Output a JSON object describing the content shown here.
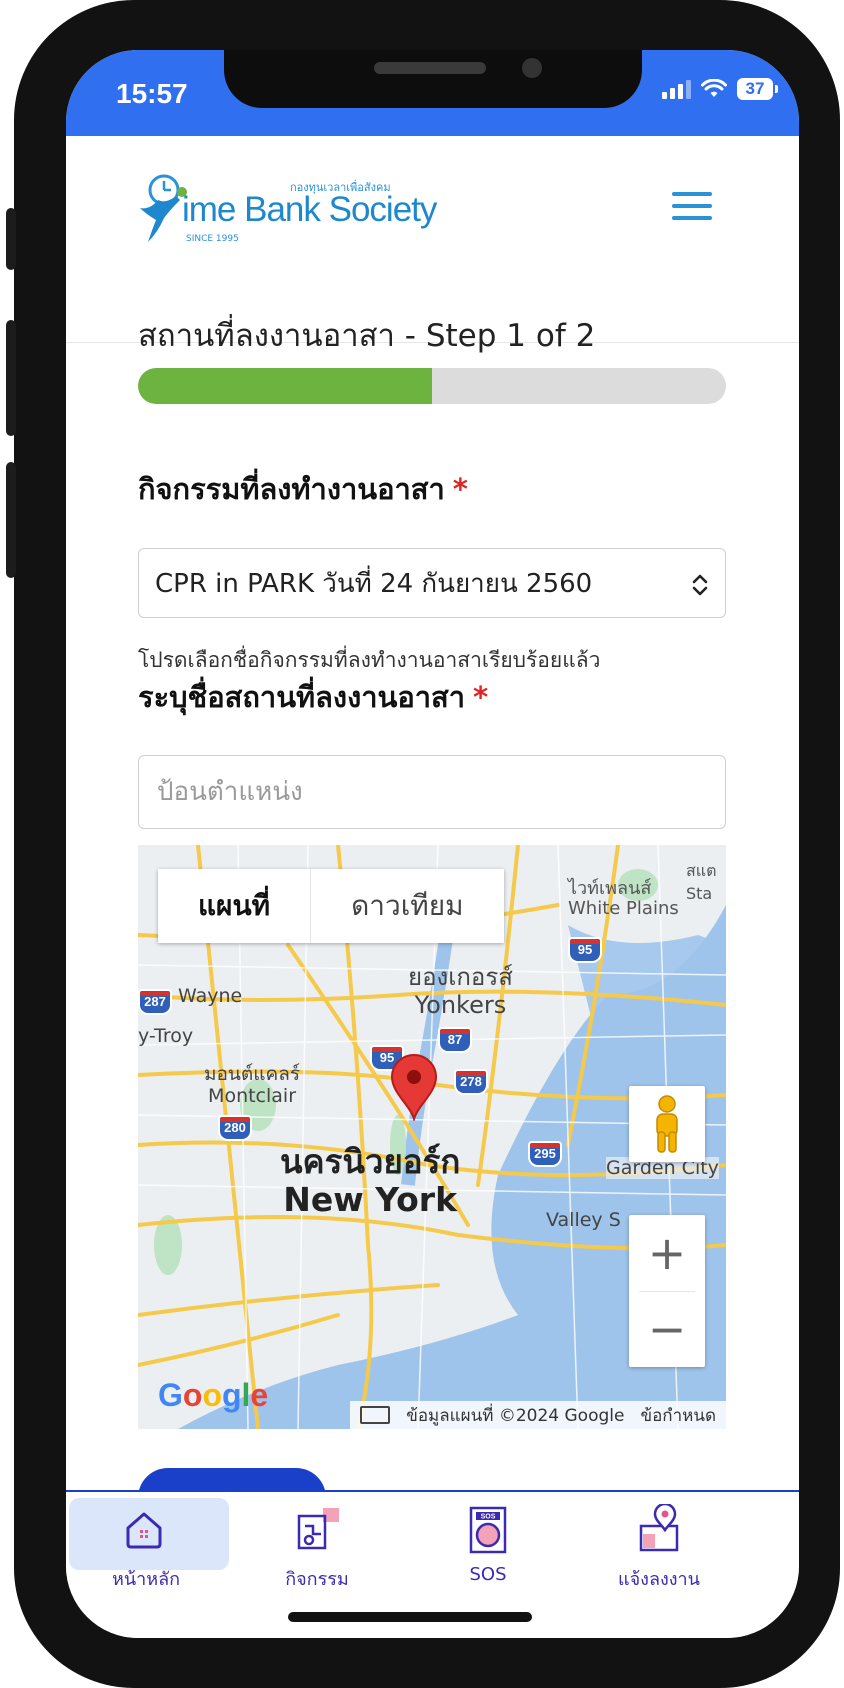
{
  "status_bar": {
    "time": "15:57",
    "battery": "37"
  },
  "header": {
    "logo_text": "ime Bank Society",
    "logo_thai": "กองทุนเวลาเพื่อสังคม",
    "logo_since": "SINCE 1995"
  },
  "form": {
    "step_title": "สถานที่ลงงานอาสา - Step 1 of 2",
    "progress": 0.5,
    "activity_label": "กิจกรรมที่ลงทำงานอาสา",
    "activity_required": "*",
    "activity_value": "CPR in PARK วันที่ 24 กันยายน  2560",
    "activity_help": "โปรดเลือกชื่อกิจกรรมที่ลงทำงานอาสาเรียบร้อยแล้ว",
    "location_label": "ระบุชื่อสถานที่ลงงานอาสา",
    "location_required": "*",
    "location_placeholder": "ป้อนตำแหน่ง"
  },
  "map": {
    "tab_map": "แผนที่",
    "tab_satellite": "ดาวเทียม",
    "labels": {
      "white_plains_th": "ไวท์เพลนส์",
      "white_plains_en": "White Plains",
      "yonkers_th": "ยองเกอรส์",
      "yonkers_en": "Yonkers",
      "wayne": "Wayne",
      "troy": "y-Troy",
      "montclair_th": "มอนต์แคลร์",
      "montclair_en": "Montclair",
      "new_york_th": "นครนิวยอร์ก",
      "new_york_en": "New York",
      "garden_city": "Garden City",
      "valley_stream": "Valley S",
      "stamford": "สแต Sta"
    },
    "highway_shields": [
      "287",
      "95",
      "87",
      "95",
      "278",
      "280",
      "295"
    ],
    "zoom_in": "+",
    "zoom_out": "−",
    "google_logo": "Google",
    "attribution": "ข้อมูลแผนที่ ©2024 Google",
    "terms": "ข้อกำหนด"
  },
  "nav": [
    {
      "label": "หน้าหลัก",
      "icon": "home-icon"
    },
    {
      "label": "กิจกรรม",
      "icon": "activity-icon"
    },
    {
      "label": "SOS",
      "icon": "sos-icon"
    },
    {
      "label": "แจ้งลงงาน",
      "icon": "report-location-icon"
    }
  ],
  "colors": {
    "status_bar": "#2f6ff0",
    "progress": "#6cb43f",
    "nav_accent": "#1a3fc9",
    "brand": "#2a92d6"
  }
}
